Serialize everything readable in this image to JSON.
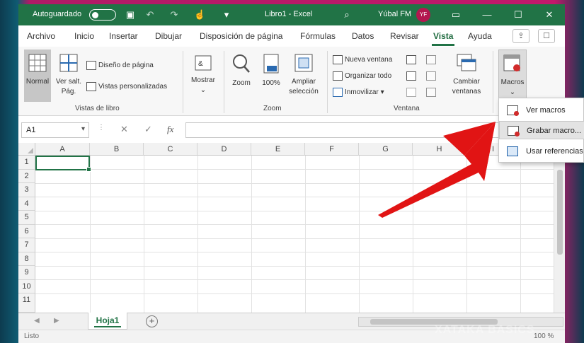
{
  "titlebar": {
    "autosave": "Autoguardado",
    "doc_title": "Libro1 - Excel",
    "user": "Yúbal FM",
    "initials": "YF"
  },
  "tabs": [
    "Archivo",
    "Inicio",
    "Insertar",
    "Dibujar",
    "Disposición de página",
    "Fórmulas",
    "Datos",
    "Revisar",
    "Vista",
    "Ayuda"
  ],
  "active_tab": "Vista",
  "ribbon": {
    "vistas_libro": {
      "label": "Vistas de libro",
      "normal": "Normal",
      "ver_salt": "Ver salt.",
      "pag": "Pág.",
      "diseno_pagina": "Diseño de página",
      "vistas_personalizadas": "Vistas personalizadas"
    },
    "mostrar": "Mostrar",
    "zoom_group": {
      "label": "Zoom",
      "zoom": "Zoom",
      "hundred": "100%",
      "ampliar": "Ampliar",
      "seleccion": "selección"
    },
    "ventana": {
      "label": "Ventana",
      "nueva_ventana": "Nueva ventana",
      "organizar_todo": "Organizar todo",
      "inmovilizar": "Inmovilizar",
      "cambiar": "Cambiar",
      "ventanas": "ventanas"
    },
    "macros": "Macros"
  },
  "formula_bar": {
    "name_box": "A1",
    "fx": "fx"
  },
  "grid": {
    "columns": [
      "A",
      "B",
      "C",
      "D",
      "E",
      "F",
      "G",
      "H",
      "I"
    ],
    "rows": [
      "1",
      "2",
      "3",
      "4",
      "5",
      "6",
      "7",
      "8",
      "9",
      "10",
      "11"
    ],
    "selected_cell": "A1"
  },
  "sheet": {
    "tab": "Hoja1",
    "add": "+"
  },
  "status": {
    "left": "Listo",
    "zoom": "100 %"
  },
  "macros_menu": {
    "items": [
      {
        "label": "Ver macros"
      },
      {
        "label": "Grabar macro..."
      },
      {
        "label": "Usar referencias relativas"
      }
    ]
  },
  "watermark": "XATAKA BASICS",
  "colors": {
    "excel_green": "#217346",
    "arrow_red": "#e11414",
    "frame_magenta": "#c2186b"
  }
}
